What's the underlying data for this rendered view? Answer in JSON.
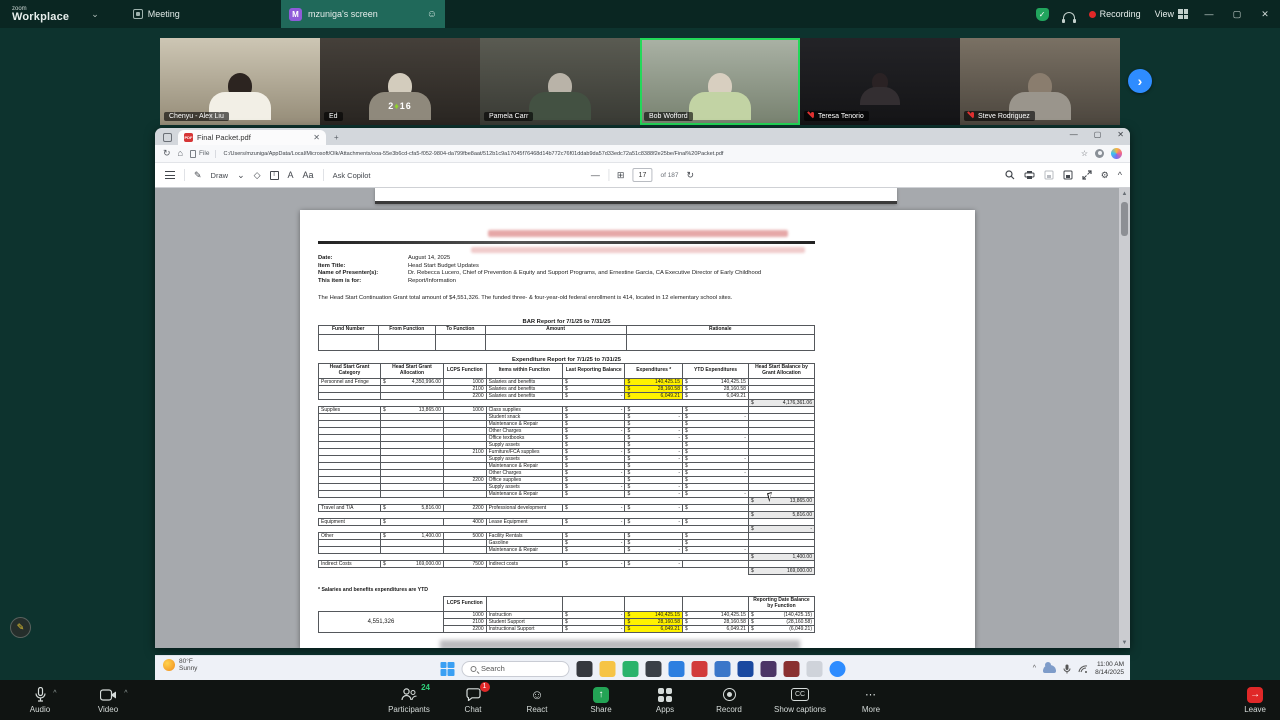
{
  "top_bar": {
    "logo_small": "zoom",
    "logo_main": "Workplace",
    "meeting_tab": "Meeting",
    "screen_tab": "mzuniga's screen",
    "screen_tab_avatar": "M",
    "recording": "Recording",
    "view": "View"
  },
  "participants": [
    {
      "name": "Chenyu - Alex Liu",
      "muted": false,
      "active": false
    },
    {
      "name": "Ed",
      "shirt_text_left": "2",
      "shirt_text_right": "16",
      "muted": false,
      "active": false
    },
    {
      "name": "Pamela Carr",
      "muted": false,
      "active": false
    },
    {
      "name": "Bob Wofford",
      "muted": false,
      "active": true
    },
    {
      "name": "Teresa Tenorio",
      "muted": true,
      "active": false
    },
    {
      "name": "Steve Rodriguez",
      "muted": true,
      "active": false
    }
  ],
  "browser": {
    "tab_title": "Final Packet.pdf",
    "pdf_badge": "PDF",
    "file_chip": "File",
    "url": "C:/Users/mzuniga/AppData/Local/Microsoft/Olk/Attachments/ooa-55e3b6cd-cfa5-f052-9804-da799fbe8aat/512b1c9a17045f76468d14b772c76f01ddab9da57d33edc72a51c8388f2e25be/Final%20Packet.pdf",
    "toolbar": {
      "draw": "Draw",
      "text_tool": "T",
      "read_aloud": "A",
      "aa": "Aa",
      "ask_copilot": "Ask Copilot",
      "page_current": "17",
      "page_of": "of 187"
    }
  },
  "document": {
    "meta": [
      {
        "label": "Date:",
        "value": "August 14, 2025"
      },
      {
        "label": "Item Title:",
        "value": "Head Start Budget Updates"
      },
      {
        "label": "Name of Presenter(s):",
        "value": "Dr. Rebecca Lucero, Chief of Prevention & Equity and Support Programs, and Ernestine Garcia, CA Executive Director of Early Childhood"
      },
      {
        "label": "This item is for:",
        "value": "Report/Information"
      }
    ],
    "intro": "The Head Start Continuation Grant total amount of $4,551,326. The funded three- & four-year-old federal enrollment is 414, located in 12 elementary school sites.",
    "bar_report": {
      "title": "BAR Report for 7/1/25 to 7/31/25",
      "headers": [
        "Fund Number",
        "From Function",
        "To Function",
        "Amount",
        "Rationale"
      ]
    },
    "expenditure_report": {
      "title": "Expenditure Report for 7/1/25 to 7/31/25",
      "headers": [
        "Head Start Grant Category",
        "Head Start Grant Allocation",
        "LCPS Function",
        "Items within Function",
        "Last Reporting Balance",
        "Expenditures *",
        "YTD Expenditures",
        "Head Start Balance by Grant Allocation"
      ],
      "rows": [
        {
          "c": [
            "Personnel and Fringe",
            "$ 4,350,996.00",
            "1000",
            "Salaries and benefits",
            "$",
            "$ 140,425.15",
            "$ 140,425.15",
            ""
          ],
          "hl": [
            5
          ]
        },
        {
          "c": [
            "",
            "",
            "2100",
            "Salaries and benefits",
            "$",
            "$ 28,160.58",
            "$ 28,160.58",
            ""
          ],
          "hl": [
            5
          ]
        },
        {
          "c": [
            "",
            "",
            "2200",
            "Salaries and benefits",
            "$ -",
            "$ 6,049.21",
            "$ 6,049.21",
            ""
          ],
          "hl": [
            5
          ]
        },
        {
          "sub": "$ 4,176,361.06"
        },
        {
          "c": [
            "Supplies",
            "$ 13,865.00",
            "1000",
            "Class supplies",
            "$ -",
            "$",
            "$",
            ""
          ]
        },
        {
          "c": [
            "",
            "",
            "",
            "Student snack",
            "$",
            "$ -",
            "$ -",
            ""
          ]
        },
        {
          "c": [
            "",
            "",
            "",
            "Maintenance & Repair",
            "$",
            "$",
            "$",
            ""
          ]
        },
        {
          "c": [
            "",
            "",
            "",
            "Other Charges",
            "$ -",
            "$ -",
            "$",
            ""
          ]
        },
        {
          "c": [
            "",
            "",
            "",
            "Office textbooks",
            "$",
            "$ -",
            "$ -",
            ""
          ]
        },
        {
          "c": [
            "",
            "",
            "",
            "Supply assets",
            "$",
            "$",
            "$",
            ""
          ]
        },
        {
          "c": [
            "",
            "",
            "2100",
            "Furniture/FCA supplies",
            "$ -",
            "$ -",
            "$",
            ""
          ]
        },
        {
          "c": [
            "",
            "",
            "",
            "Supply assets",
            "$",
            "$ -",
            "$ -",
            ""
          ]
        },
        {
          "c": [
            "",
            "",
            "",
            "Maintenance & Repair",
            "$",
            "$",
            "$",
            ""
          ]
        },
        {
          "c": [
            "",
            "",
            "",
            "Other Charges",
            "$ -",
            "$ -",
            "$ -",
            ""
          ]
        },
        {
          "c": [
            "",
            "",
            "2200",
            "Office supplies",
            "$",
            "$",
            "$",
            ""
          ]
        },
        {
          "c": [
            "",
            "",
            "",
            "Supply assets",
            "$ -",
            "$ -",
            "$",
            ""
          ]
        },
        {
          "c": [
            "",
            "",
            "",
            "Maintenance & Repair",
            "$",
            "$ -",
            "$ -",
            ""
          ]
        },
        {
          "sub": "$ 13,865.00"
        },
        {
          "c": [
            "Travel and T/A",
            "$ 5,816.00",
            "2200",
            "Professional development",
            "$ -",
            "$ -",
            "$",
            ""
          ]
        },
        {
          "sub": "$ 5,816.00"
        },
        {
          "c": [
            "Equipment",
            "$",
            "4000",
            "Lease Equipment",
            "$ -",
            "$ -",
            "$",
            ""
          ]
        },
        {
          "sub": "$ -"
        },
        {
          "c": [
            "Other",
            "$ 1,400.00",
            "5000",
            "Facility Rentals",
            "$",
            "$",
            "$",
            ""
          ]
        },
        {
          "c": [
            "",
            "",
            "",
            "Gasoline",
            "$ -",
            "$",
            "$",
            ""
          ]
        },
        {
          "c": [
            "",
            "",
            "",
            "Maintenance & Repair",
            "$",
            "$ -",
            "$ -",
            ""
          ]
        },
        {
          "sub": "$ 1,400.00"
        },
        {
          "c": [
            "Indirect Costs",
            "$ 169,000.00",
            "7500",
            "Indirect costs",
            "$ -",
            "$ -",
            "",
            ""
          ]
        },
        {
          "sub": "$ 169,000.00"
        }
      ],
      "footnote": "* Salaries and benefits expenditures are YTD"
    },
    "summary_table": {
      "function_header": "LCPS Function",
      "balance_header": "Reporting Date Balance by Function",
      "total": "4,551,326",
      "rows": [
        {
          "c": [
            "1000",
            "Instruction",
            "$ -",
            "$ 140,425.15",
            "$ 140,425.15",
            "$ (140,425.15)"
          ],
          "hl": [
            3
          ]
        },
        {
          "c": [
            "2100",
            "Student Support",
            "$",
            "$ 28,160.58",
            "$ 28,160.58",
            "$ (28,160.58)"
          ],
          "hl": [
            3
          ]
        },
        {
          "c": [
            "2200",
            "Instructional Support",
            "$ -",
            "$ 6,049.21",
            "$ 6,049.21",
            "$ (6,049.21)"
          ],
          "hl": [
            3
          ]
        }
      ]
    }
  },
  "taskbar": {
    "weather_temp": "80°F",
    "weather_desc": "Sunny",
    "search": "Search",
    "apps": [
      {
        "name": "task-view",
        "color": "#35383d"
      },
      {
        "name": "file-explorer",
        "color": "#f6c445"
      },
      {
        "name": "app-green",
        "color": "#2ab36b"
      },
      {
        "name": "app-dark-orange",
        "color": "#3a3f46"
      },
      {
        "name": "outlook",
        "color": "#2d7fe0"
      },
      {
        "name": "app-red",
        "color": "#d23b3b"
      },
      {
        "name": "edge",
        "color": "#3b77c9"
      },
      {
        "name": "word",
        "color": "#1a49a0"
      },
      {
        "name": "app-purple",
        "color": "#4b3566"
      },
      {
        "name": "app-maroon",
        "color": "#8a3030"
      },
      {
        "name": "snipping",
        "color": "#cfd3da"
      },
      {
        "name": "zoom-app",
        "color": "#2d8cff"
      }
    ],
    "clock_time": "11:00 AM",
    "clock_date": "8/14/2025"
  },
  "controls": {
    "audio": "Audio",
    "video": "Video",
    "participants": "Participants",
    "participants_count": "24",
    "chat": "Chat",
    "chat_badge": "1",
    "react": "React",
    "share": "Share",
    "apps": "Apps",
    "record": "Record",
    "captions": "Show captions",
    "more": "More",
    "leave": "Leave"
  },
  "icons": {
    "chevron_down": "⌄",
    "chevron_up": "^",
    "minimize": "—",
    "maximize": "▢",
    "close": "✕",
    "plus": "+",
    "smiley": "☺",
    "star": "☆",
    "gear": "⚙",
    "home": "⌂",
    "refresh": "↻",
    "fit_page": "⊞",
    "rotate": "↻",
    "dots": "⋯",
    "arrow_right": "→",
    "up_arrow": "↑",
    "minus": "—",
    "pipe": "|",
    "pencil": "✎",
    "next": "›",
    "sb_up": "▲",
    "sb_down": "▼",
    "eraser": "◇",
    "highlighter": "✎"
  },
  "colors": {
    "active_speaker_green": "#23d959",
    "recording_red": "#e02828",
    "share_green": "#23a455",
    "leave_red": "#e02828",
    "highlight_yellow": "#fff200",
    "tab_active_green": "#20695a"
  }
}
